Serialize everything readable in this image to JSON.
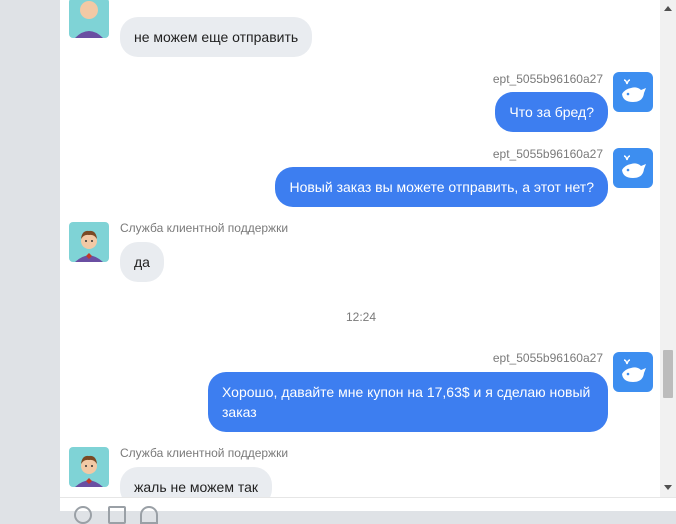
{
  "messages": {
    "m1": {
      "text": "не можем еще отправить"
    },
    "m2": {
      "sender": "ept_5055b96160a27",
      "text": "Что за бред?"
    },
    "m3": {
      "sender": "ept_5055b96160a27",
      "text": "Новый заказ вы можете отправить, а этот нет?"
    },
    "m4": {
      "sender": "Служба клиентной поддержки",
      "text": "да"
    },
    "time": "12:24",
    "m5": {
      "sender": "ept_5055b96160a27",
      "text": "Хорошо, давайте мне купон на 17,63$ и я сделаю новый заказ"
    },
    "m6": {
      "sender": "Служба клиентной поддержки",
      "text": "жаль не можем так"
    }
  },
  "colors": {
    "user_bubble": "#3d7ef0",
    "agent_bubble": "#e9ecf0",
    "avatar_user": "#3d8ef0"
  }
}
